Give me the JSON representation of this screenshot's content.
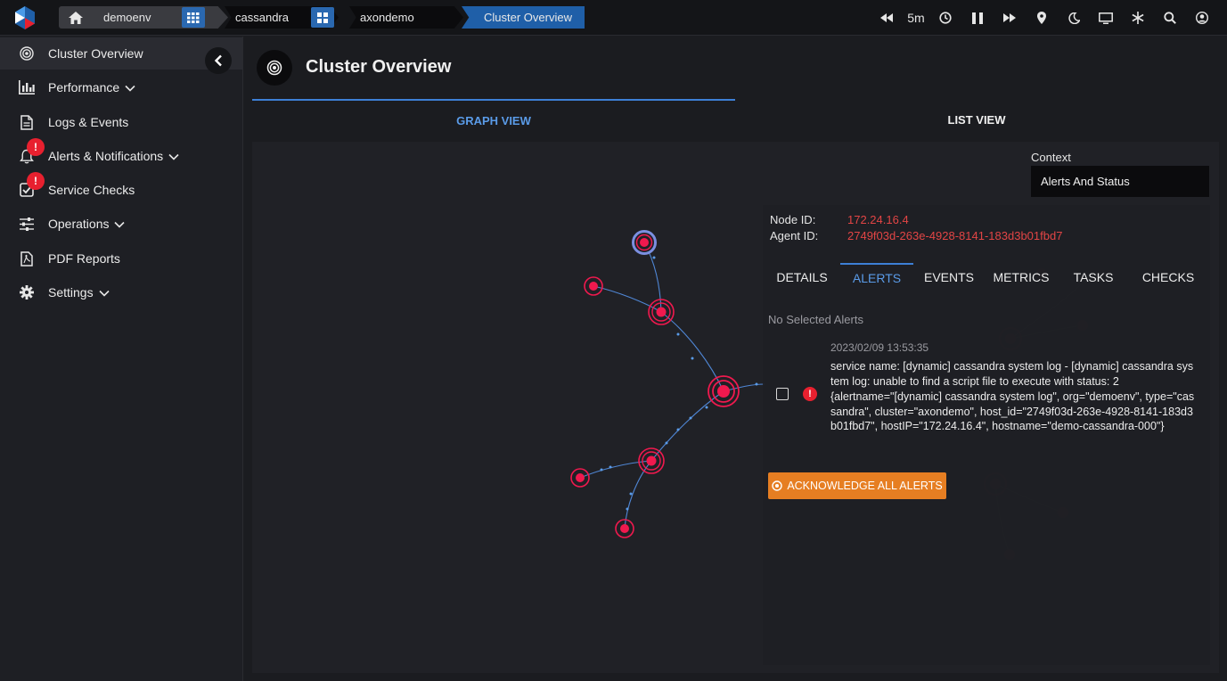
{
  "topbar": {
    "breadcrumbs": {
      "env": "demoenv",
      "app": "cassandra",
      "cluster": "axondemo",
      "current": "Cluster Overview"
    },
    "time_range": "5m",
    "icons": [
      "rewind-icon",
      "clock-icon",
      "pause-icon",
      "fast-forward-icon",
      "location-pin-icon",
      "moon-icon",
      "monitor-icon",
      "snowflake-icon",
      "search-icon",
      "user-icon"
    ]
  },
  "sidebar": {
    "items": [
      {
        "label": "Cluster Overview",
        "icon": "target-icon"
      },
      {
        "label": "Performance",
        "icon": "bar-chart-icon"
      },
      {
        "label": "Logs & Events",
        "icon": "document-icon"
      },
      {
        "label": "Alerts & Notifications",
        "icon": "bell-icon",
        "badge": "!"
      },
      {
        "label": "Service Checks",
        "icon": "checkbox-icon",
        "badge": "!"
      },
      {
        "label": "Operations",
        "icon": "sliders-icon"
      },
      {
        "label": "PDF Reports",
        "icon": "pdf-icon"
      },
      {
        "label": "Settings",
        "icon": "gear-icon"
      }
    ]
  },
  "main": {
    "title": "Cluster Overview",
    "tabs": [
      {
        "label": "GRAPH VIEW"
      },
      {
        "label": "LIST VIEW"
      }
    ],
    "context": {
      "label": "Context",
      "value": "Alerts And Status"
    }
  },
  "node_panel": {
    "node_id_label": "Node ID:",
    "node_id": "172.24.16.4",
    "agent_id_label": "Agent ID:",
    "agent_id": "2749f03d-263e-4928-8141-183d3b01fbd7",
    "tabs": [
      "DETAILS",
      "ALERTS",
      "EVENTS",
      "METRICS",
      "TASKS",
      "CHECKS"
    ],
    "no_selection": "No Selected Alerts",
    "alert": {
      "time": "2023/02/09 13:53:35",
      "message": "service name: [dynamic] cassandra system log - [dynamic] cassandra system log: unable to find a script file to execute with status: 2",
      "labels": "{alertname=\"[dynamic] cassandra system log\", org=\"demoenv\", type=\"cassandra\", cluster=\"axondemo\", host_id=\"2749f03d-263e-4928-8141-183d3b01fbd7\", hostIP=\"172.24.16.4\", hostname=\"demo-cassandra-000\"}"
    },
    "ack_button": "ACKNOWLEDGE ALL ALERTS"
  },
  "colors": {
    "accent": "#3d7fd6",
    "node_red": "#f0194e",
    "alert_orange": "#e67e22",
    "id_red": "#e24545"
  }
}
